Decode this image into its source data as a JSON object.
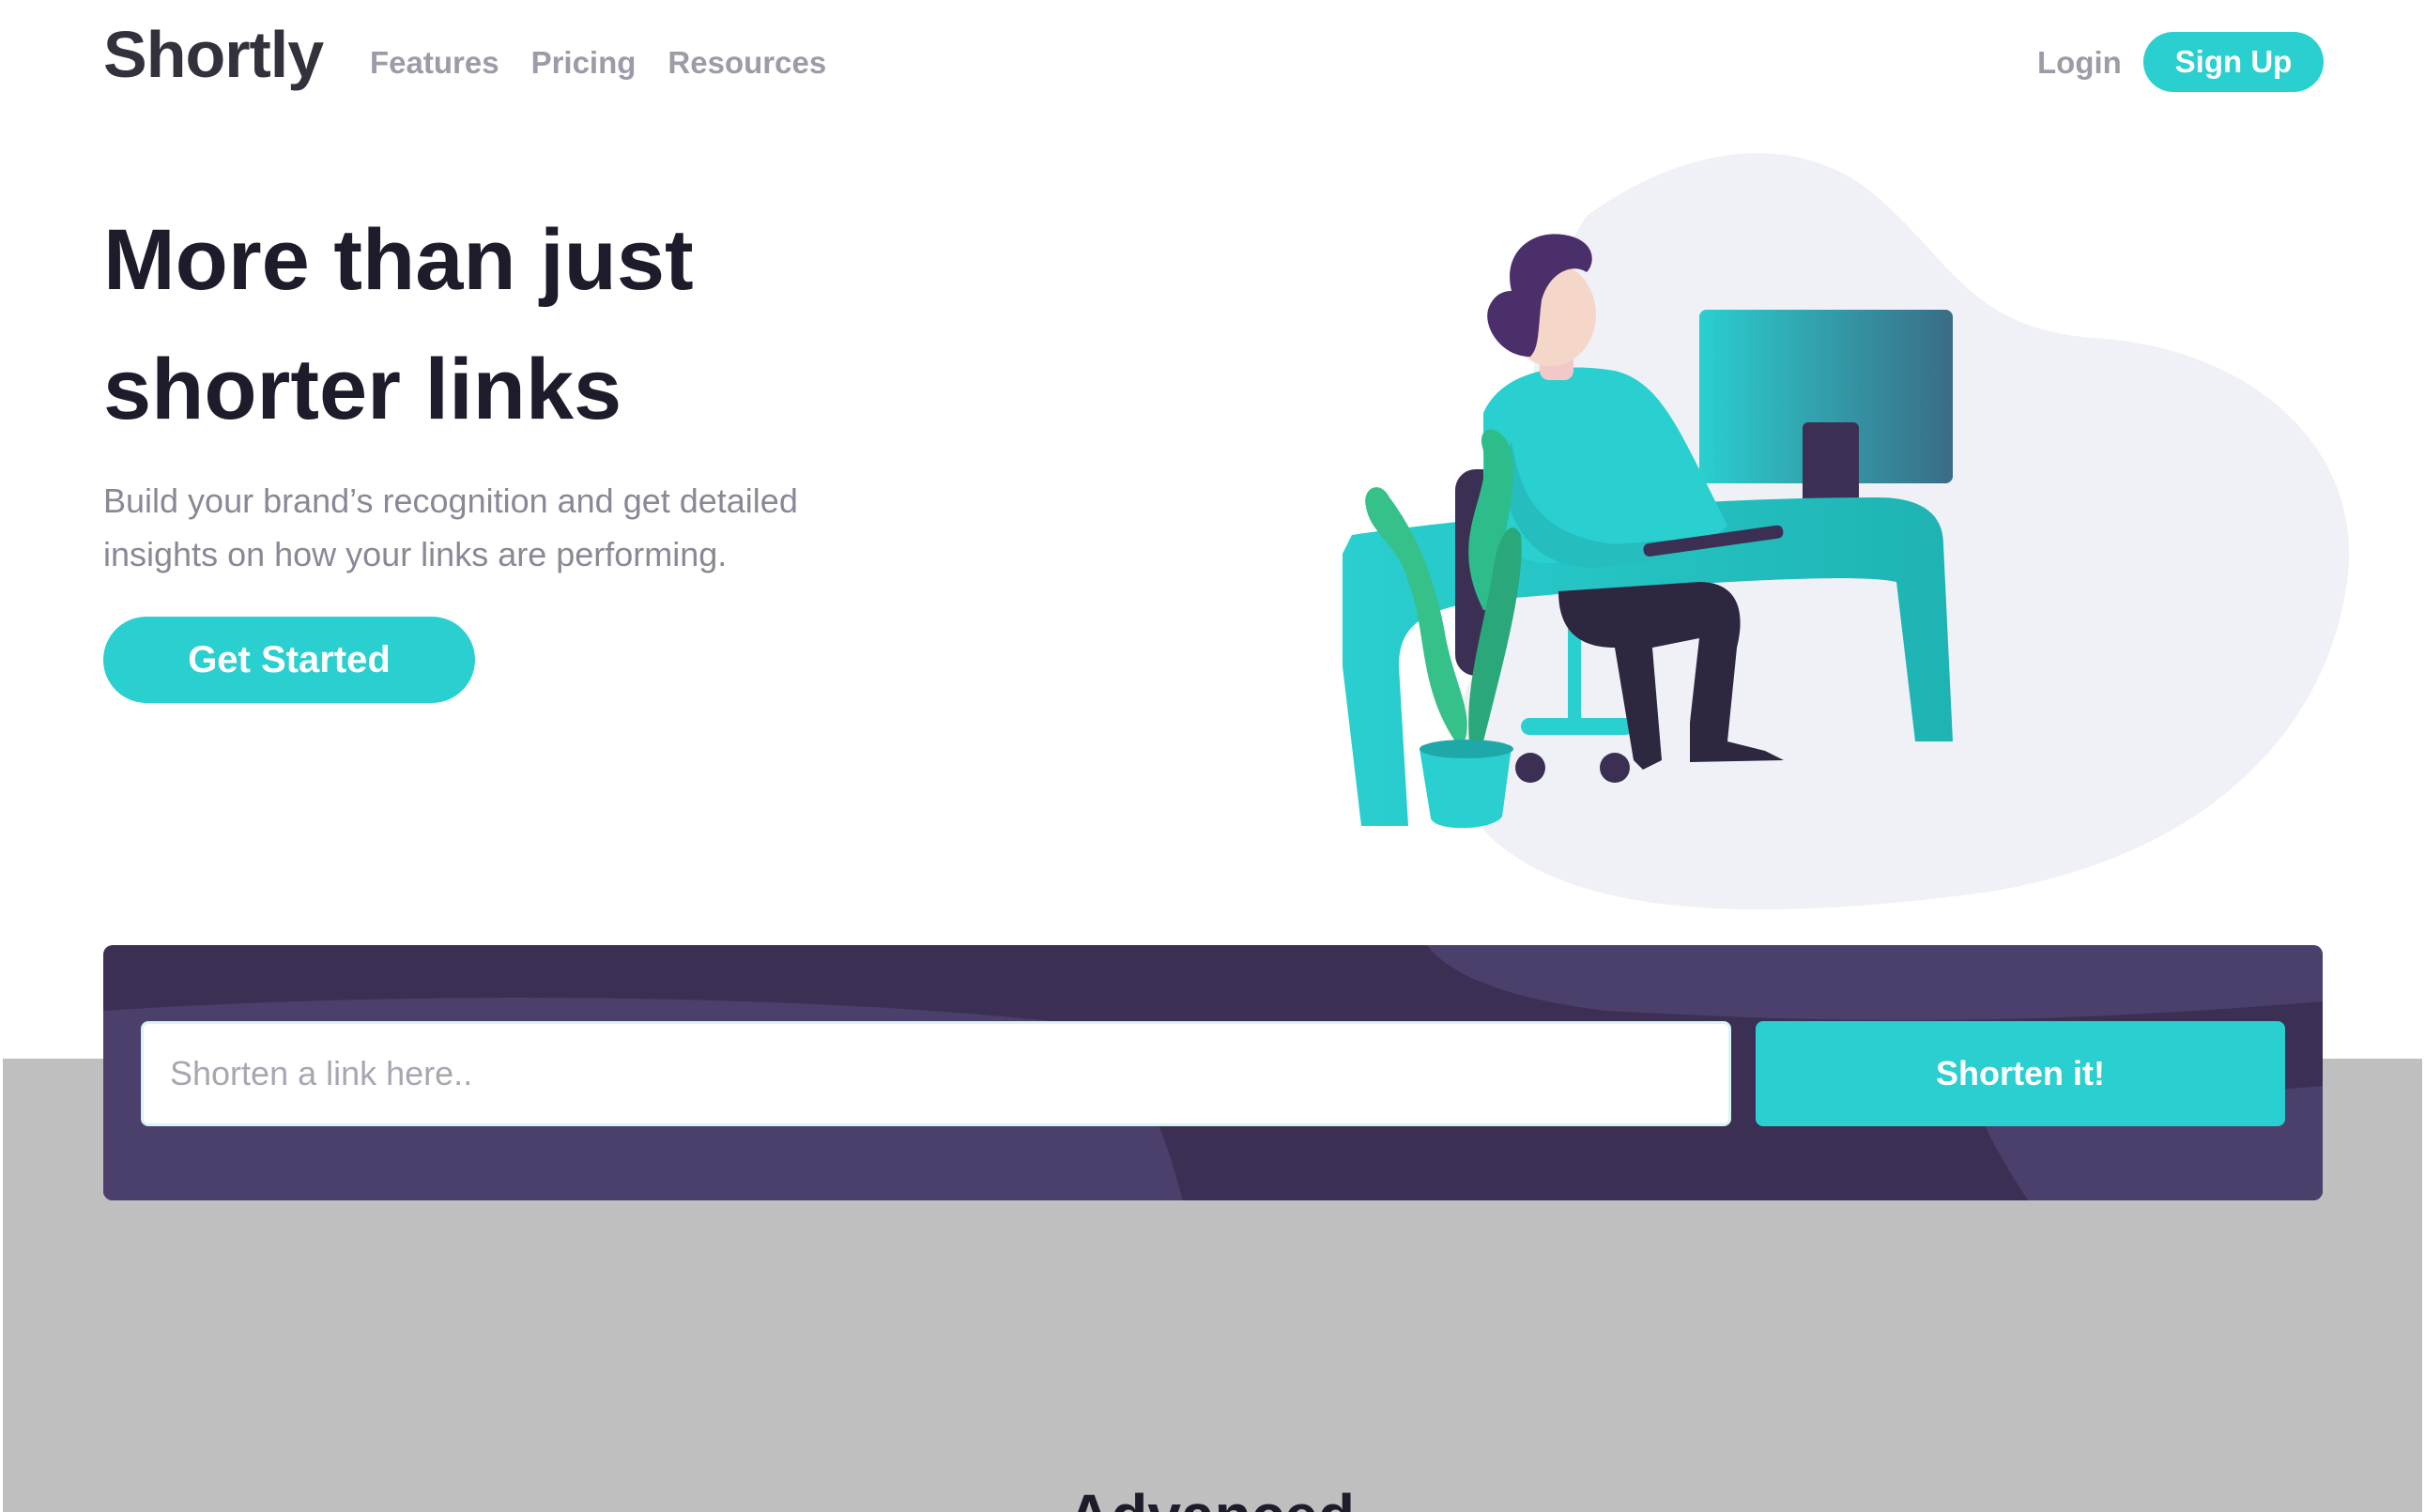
{
  "brand": {
    "logo_text": "Shortly",
    "accent_color": "#2acfcf",
    "dark_violet": "#3b3054"
  },
  "nav": {
    "items": [
      {
        "label": "Features"
      },
      {
        "label": "Pricing"
      },
      {
        "label": "Resources"
      }
    ],
    "login_label": "Login",
    "signup_label": "Sign Up"
  },
  "hero": {
    "title_line1": "More than just",
    "title_line2": "shorter links",
    "subtitle_line1": "Build your brand’s recognition and get detailed",
    "subtitle_line2": "insights on how your links are performing.",
    "cta_label": "Get Started",
    "illustration_icon": "person-working-at-desk-illustration"
  },
  "shortener": {
    "input_placeholder": "Shorten a link here..",
    "button_label": "Shorten it!"
  },
  "next_section": {
    "title_fragment": "Advanced Statistics"
  }
}
